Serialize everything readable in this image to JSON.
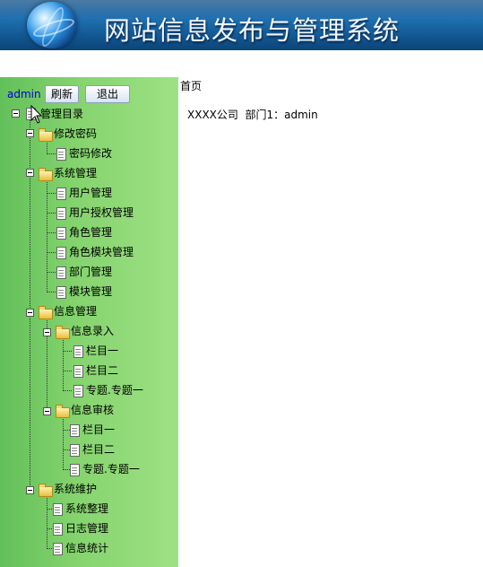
{
  "header": {
    "title": "网站信息发布与管理系统"
  },
  "sidebar": {
    "user": "admin",
    "refresh_label": "刷新",
    "logout_label": "退出",
    "tree": {
      "root": "管理目录",
      "change_password": "修改密码",
      "password_edit": "密码修改",
      "system_mgmt": "系统管理",
      "user_mgmt": "用户管理",
      "user_auth": "用户授权管理",
      "role_mgmt": "角色管理",
      "role_module": "角色模块管理",
      "dept_mgmt": "部门管理",
      "module_mgmt": "模块管理",
      "info_mgmt": "信息管理",
      "info_entry": "信息录入",
      "entry_col1": "栏目一",
      "entry_col2": "栏目二",
      "entry_special": "专题.专题一",
      "info_review": "信息审核",
      "review_col1": "栏目一",
      "review_col2": "栏目二",
      "review_special": "专题.专题一",
      "sys_maint": "系统维护",
      "sys_cleanup": "系统整理",
      "log_mgmt": "日志管理",
      "info_stats": "信息统计"
    }
  },
  "main": {
    "page_title": "首页",
    "info_line": "XXXX公司  部门1：admin"
  }
}
